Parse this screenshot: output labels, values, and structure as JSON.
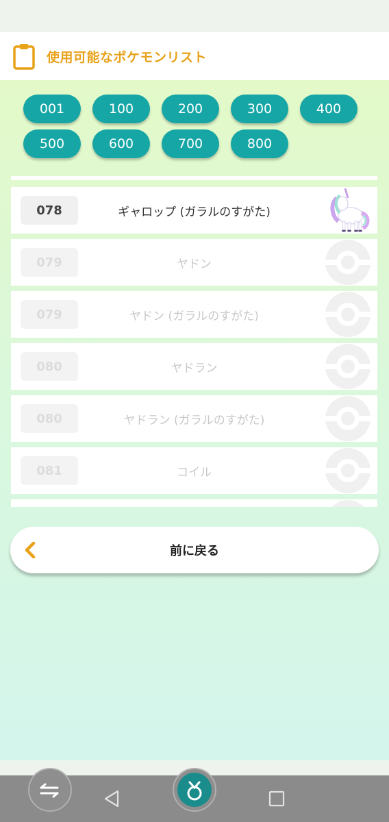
{
  "header": {
    "title": "使用可能なポケモンリスト",
    "icon": "clipboard-icon"
  },
  "ranges": [
    "001",
    "100",
    "200",
    "300",
    "400",
    "500",
    "600",
    "700",
    "800"
  ],
  "list": [
    {
      "number": "078",
      "name": "ギャロップ (ガラルのすがた)",
      "available": true,
      "icon": "galarian-ponyta-sprite"
    },
    {
      "number": "079",
      "name": "ヤドン",
      "available": false,
      "icon": "pokeball-icon"
    },
    {
      "number": "079",
      "name": "ヤドン (ガラルのすがた)",
      "available": false,
      "icon": "pokeball-icon"
    },
    {
      "number": "080",
      "name": "ヤドラン",
      "available": false,
      "icon": "pokeball-icon"
    },
    {
      "number": "080",
      "name": "ヤドラン (ガラルのすがた)",
      "available": false,
      "icon": "pokeball-icon"
    },
    {
      "number": "081",
      "name": "コイル",
      "available": false,
      "icon": "pokeball-icon"
    }
  ],
  "back": {
    "label": "前に戻る",
    "icon": "chevron-left-icon"
  },
  "colors": {
    "accent": "#e8a21a",
    "teal": "#17a6a6"
  }
}
